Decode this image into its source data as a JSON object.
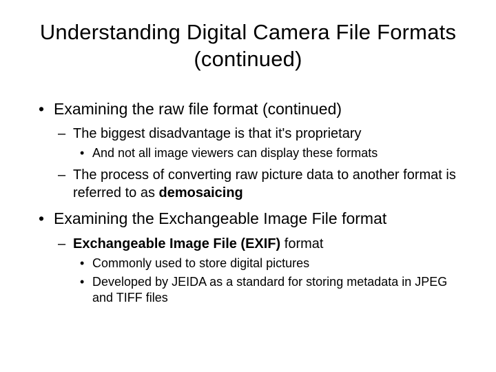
{
  "title": "Understanding Digital Camera File Formats (continued)",
  "bullets": [
    {
      "text": "Examining the raw file format (continued)",
      "children": [
        {
          "text": "The biggest disadvantage is that it's proprietary",
          "children": [
            {
              "text": "And not all image viewers can display these formats"
            }
          ]
        },
        {
          "pre": "The process of converting raw picture data to another format is referred to as ",
          "bold": "demosaicing"
        }
      ]
    },
    {
      "text": "Examining the Exchangeable Image File format",
      "children": [
        {
          "bold": "Exchangeable Image File (EXIF)",
          "post": " format",
          "children": [
            {
              "text": "Commonly used to store digital pictures"
            },
            {
              "text": "Developed by JEIDA as a standard for storing metadata in JPEG and TIFF files"
            }
          ]
        }
      ]
    }
  ]
}
